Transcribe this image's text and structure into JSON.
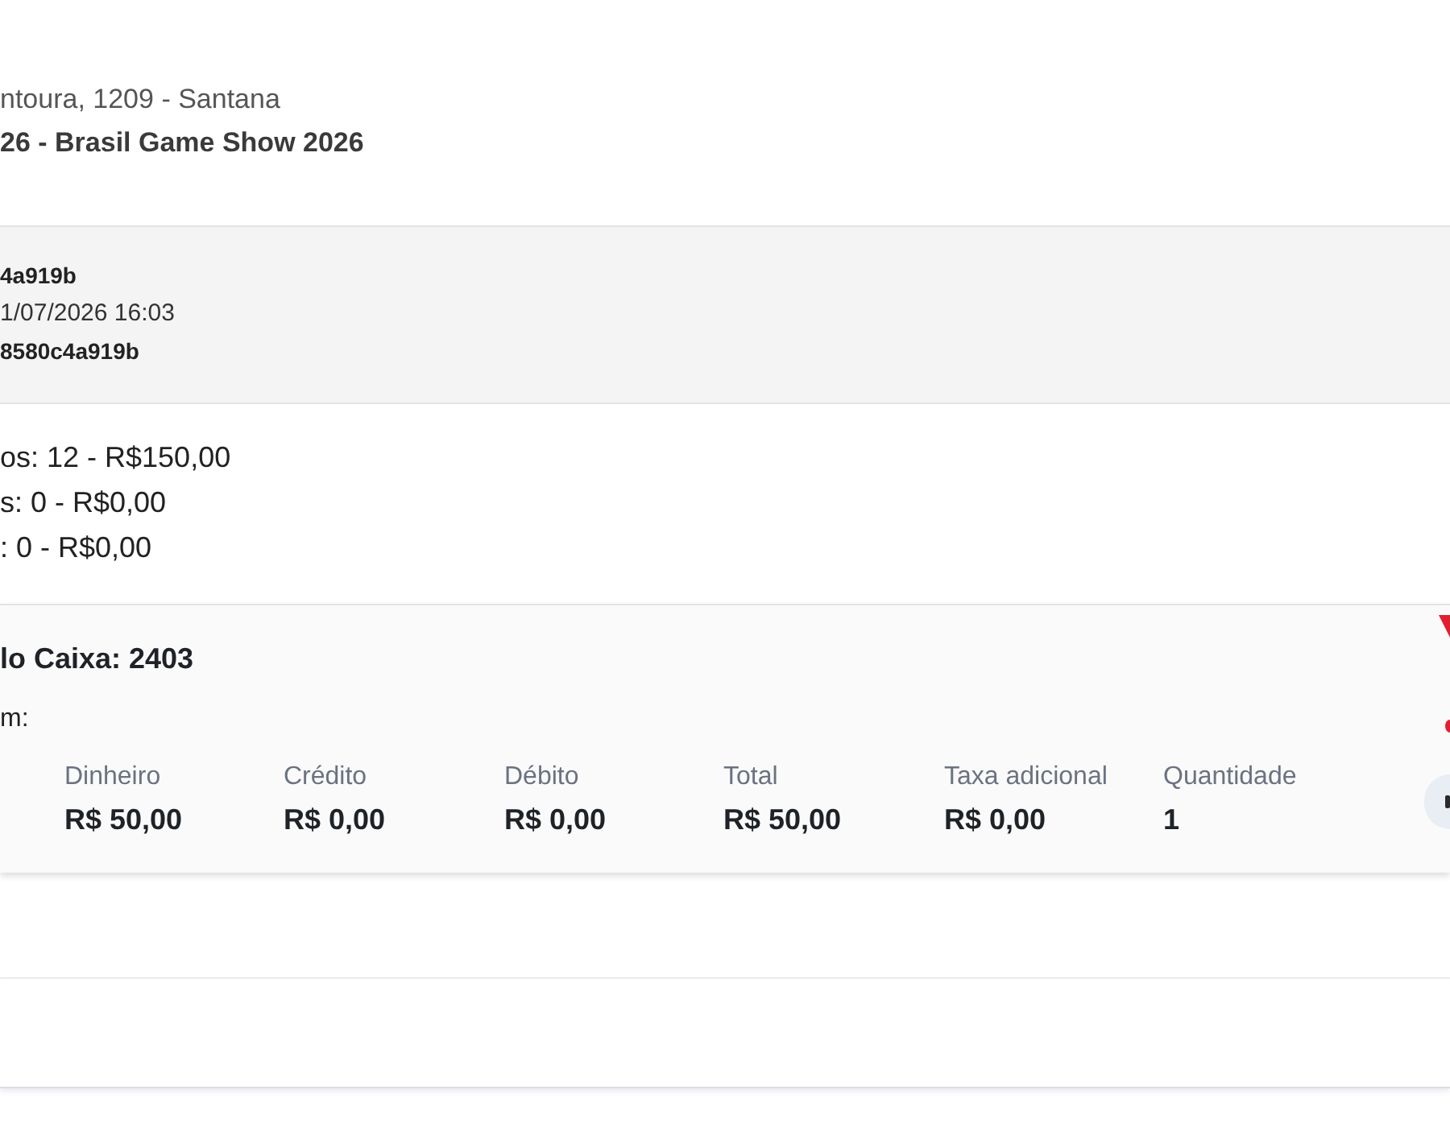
{
  "location": {
    "address": "ntoura, 1209 - Santana",
    "event": "26 - Brasil Game Show 2026"
  },
  "order": {
    "lines": [
      {
        "kind": "code",
        "text": "4a919b"
      },
      {
        "kind": "date",
        "text": "1/07/2026 16:03"
      },
      {
        "kind": "code",
        "text": "8580c4a919b"
      }
    ]
  },
  "summary": {
    "lines": [
      "os: 12 - R$150,00",
      "s: 0 - R$0,00",
      ": 0 - R$0,00"
    ]
  },
  "cash_card": {
    "title": "lo Caixa: 2403",
    "subtitle": "m:",
    "columns": [
      {
        "label": "Dinheiro",
        "value": "R$ 50,00"
      },
      {
        "label": "Crédito",
        "value": "R$ 0,00"
      },
      {
        "label": "Débito",
        "value": "R$ 0,00"
      },
      {
        "label": "Total",
        "value": "R$ 50,00"
      },
      {
        "label": "Taxa adicional",
        "value": "R$ 0,00"
      },
      {
        "label": "Quantidade",
        "value": "1"
      }
    ]
  }
}
